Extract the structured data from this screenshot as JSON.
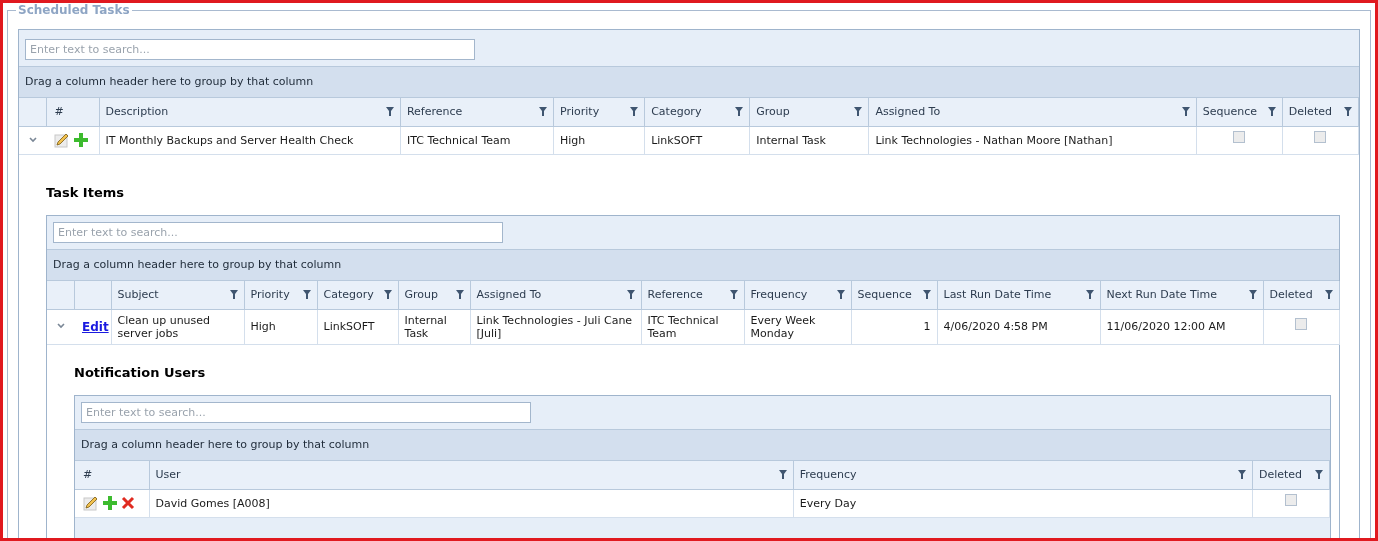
{
  "fieldset": {
    "legend": "Scheduled Tasks"
  },
  "grid": {
    "search_placeholder": "Enter text to search...",
    "group_panel": "Drag a column header here to group by that column",
    "action_header": "#",
    "columns": [
      {
        "label": "Description",
        "filter": true
      },
      {
        "label": "Reference",
        "filter": true
      },
      {
        "label": "Priority",
        "filter": true
      },
      {
        "label": "Category",
        "filter": true
      },
      {
        "label": "Group",
        "filter": true
      },
      {
        "label": "Assigned To",
        "filter": true
      },
      {
        "label": "Sequence",
        "filter": true
      },
      {
        "label": "Deleted",
        "filter": true
      }
    ],
    "rows": [
      {
        "expanded": true,
        "actions": [
          {
            "kind": "edit"
          },
          {
            "kind": "add"
          }
        ],
        "cells": [
          {
            "kind": "text",
            "text": "IT Monthly Backups and Server Health Check"
          },
          {
            "kind": "text",
            "text": "ITC Technical Team"
          },
          {
            "kind": "text",
            "text": "High"
          },
          {
            "kind": "text",
            "text": "LinkSOFT"
          },
          {
            "kind": "text",
            "text": "Internal Task"
          },
          {
            "kind": "text",
            "text": "Link Technologies - Nathan Moore [Nathan]"
          },
          {
            "kind": "checkbox",
            "checked": false
          },
          {
            "kind": "checkbox",
            "checked": false
          }
        ],
        "detail": {
          "title": "Task Items",
          "grid": {
            "search_placeholder": "Enter text to search...",
            "group_panel": "Drag a column header here to group by that column",
            "columns": [
              {
                "label": "Subject",
                "filter": true
              },
              {
                "label": "Priority",
                "filter": true
              },
              {
                "label": "Category",
                "filter": true
              },
              {
                "label": "Group",
                "filter": true
              },
              {
                "label": "Assigned To",
                "filter": true
              },
              {
                "label": "Reference",
                "filter": true
              },
              {
                "label": "Frequency",
                "filter": true
              },
              {
                "label": "Sequence",
                "filter": true
              },
              {
                "label": "Last Run Date Time",
                "filter": true
              },
              {
                "label": "Next Run Date Time",
                "filter": true
              },
              {
                "label": "Deleted",
                "filter": true
              }
            ],
            "rows": [
              {
                "expanded": true,
                "actions": [
                  {
                    "kind": "link",
                    "label": "Edit"
                  }
                ],
                "cells": [
                  {
                    "kind": "text",
                    "text": "Clean up unused server jobs"
                  },
                  {
                    "kind": "text",
                    "text": "High"
                  },
                  {
                    "kind": "text",
                    "text": "LinkSOFT"
                  },
                  {
                    "kind": "text",
                    "text": "Internal Task"
                  },
                  {
                    "kind": "text",
                    "text": "Link Technologies - Juli Cane [Juli]"
                  },
                  {
                    "kind": "text",
                    "text": "ITC Technical Team"
                  },
                  {
                    "kind": "text",
                    "text": "Every Week Monday"
                  },
                  {
                    "kind": "number",
                    "text": "1"
                  },
                  {
                    "kind": "text",
                    "text": "4/06/2020 4:58 PM"
                  },
                  {
                    "kind": "text",
                    "text": "11/06/2020 12:00 AM"
                  },
                  {
                    "kind": "checkbox",
                    "checked": false
                  }
                ],
                "detail": {
                  "title": "Notification Users",
                  "grid": {
                    "search_placeholder": "Enter text to search...",
                    "group_panel": "Drag a column header here to group by that column",
                    "action_header": "#",
                    "columns": [
                      {
                        "label": "User",
                        "filter": true
                      },
                      {
                        "label": "Frequency",
                        "filter": true
                      },
                      {
                        "label": "Deleted",
                        "filter": true
                      }
                    ],
                    "rows": [
                      {
                        "actions": [
                          {
                            "kind": "edit"
                          },
                          {
                            "kind": "add"
                          },
                          {
                            "kind": "delete"
                          }
                        ],
                        "cells": [
                          {
                            "kind": "text",
                            "text": "David Gomes [A008]"
                          },
                          {
                            "kind": "text",
                            "text": "Every Day"
                          },
                          {
                            "kind": "checkbox",
                            "checked": false
                          }
                        ]
                      }
                    ]
                  }
                }
              }
            ]
          }
        }
      }
    ]
  }
}
